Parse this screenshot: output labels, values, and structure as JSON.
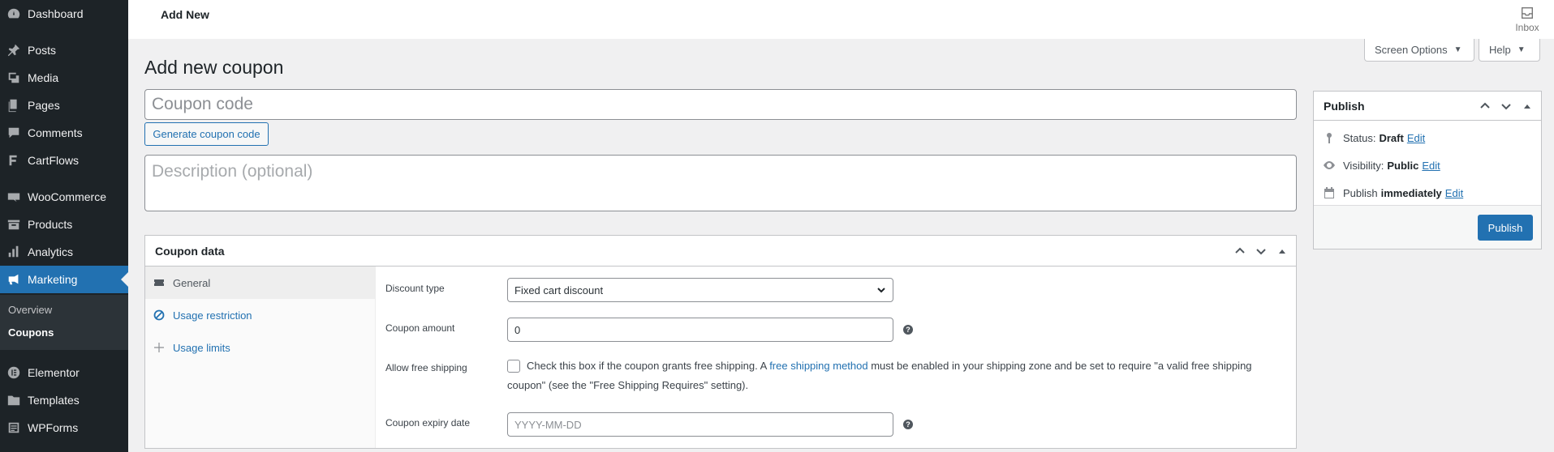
{
  "sidebar": {
    "items": [
      {
        "label": "Dashboard",
        "icon": "dashboard-icon"
      },
      {
        "label": "Posts",
        "icon": "pin-icon"
      },
      {
        "label": "Media",
        "icon": "media-icon"
      },
      {
        "label": "Pages",
        "icon": "pages-icon"
      },
      {
        "label": "Comments",
        "icon": "comment-icon"
      },
      {
        "label": "CartFlows",
        "icon": "cartflows-icon"
      },
      {
        "label": "WooCommerce",
        "icon": "woocommerce-icon"
      },
      {
        "label": "Products",
        "icon": "archive-icon"
      },
      {
        "label": "Analytics",
        "icon": "bar-chart-icon"
      },
      {
        "label": "Marketing",
        "icon": "megaphone-icon"
      },
      {
        "label": "Elementor",
        "icon": "elementor-icon"
      },
      {
        "label": "Templates",
        "icon": "folder-icon"
      },
      {
        "label": "WPForms",
        "icon": "form-icon"
      }
    ],
    "submenu": [
      {
        "label": "Overview"
      },
      {
        "label": "Coupons"
      }
    ],
    "active_color": "#2271b1"
  },
  "topbar": {
    "title": "Add New",
    "inbox_label": "Inbox"
  },
  "screen_options": {
    "label": "Screen Options"
  },
  "help": {
    "label": "Help"
  },
  "page_title": "Add new coupon",
  "coupon_code": {
    "placeholder": "Coupon code",
    "value": ""
  },
  "generate_button": "Generate coupon code",
  "description": {
    "placeholder": "Description (optional)"
  },
  "coupon_data": {
    "title": "Coupon data",
    "tabs": [
      {
        "label": "General",
        "icon": "ticket-icon"
      },
      {
        "label": "Usage restriction",
        "icon": "block-icon"
      },
      {
        "label": "Usage limits",
        "icon": "plus-icon"
      }
    ],
    "fields": {
      "discount_type": {
        "label": "Discount type",
        "value": "Fixed cart discount"
      },
      "coupon_amount": {
        "label": "Coupon amount",
        "value": "0"
      },
      "free_shipping": {
        "label": "Allow free shipping",
        "text_before": "Check this box if the coupon grants free shipping. A ",
        "link": "free shipping method",
        "text_after": " must be enabled in your shipping zone and be set to require \"a valid free shipping coupon\" (see the \"Free Shipping Requires\" setting).",
        "checked": false
      },
      "expiry_date": {
        "label": "Coupon expiry date",
        "placeholder": "YYYY-MM-DD"
      }
    },
    "help_tip_glyph": "?"
  },
  "publish": {
    "title": "Publish",
    "status": {
      "label": "Status:",
      "value": "Draft",
      "edit": "Edit"
    },
    "visibility": {
      "label": "Visibility:",
      "value": "Public",
      "edit": "Edit"
    },
    "schedule": {
      "label": "Publish",
      "value": "immediately",
      "edit": "Edit"
    },
    "button": "Publish"
  }
}
